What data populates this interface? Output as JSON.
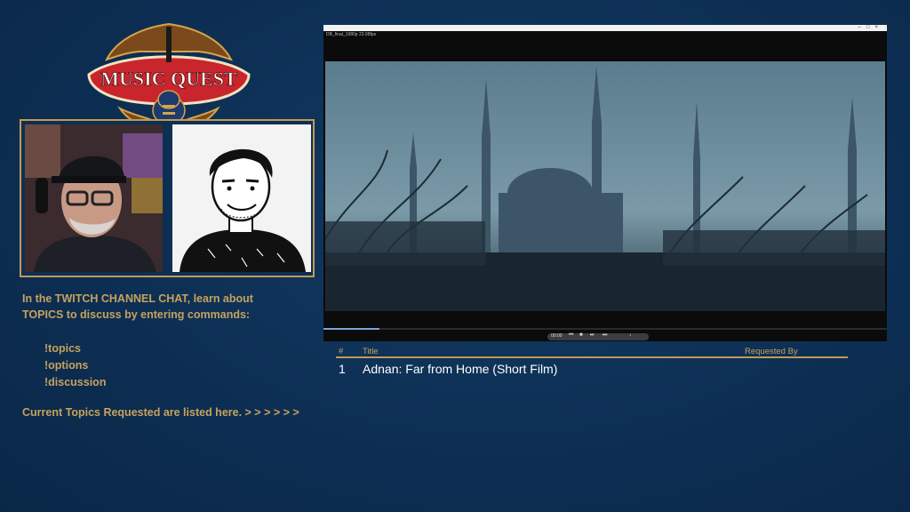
{
  "logo": {
    "text": "MUSIC QUEST"
  },
  "info": {
    "line1": "In the TWITCH CHANNEL CHAT, learn about",
    "line2": "TOPICS to discuss by entering commands:",
    "commands": [
      "!topics",
      "!options",
      "!discussion"
    ],
    "current": "Current Topics Requested are listed here. > > > > > >"
  },
  "player": {
    "window_title": "DB_final_1080p 23.98fps",
    "time": "00:00",
    "progress": 0.1
  },
  "queue": {
    "headers": {
      "num": "#",
      "title": "Title",
      "requested_by": "Requested By"
    },
    "rows": [
      {
        "num": "1",
        "title": "Adnan: Far from Home (Short Film)",
        "requested_by": ""
      }
    ]
  },
  "colors": {
    "accent": "#c7a25e",
    "background": "#0d2f54",
    "logo_red": "#c8262c"
  },
  "icons": [
    "guitar-icon",
    "previous-icon",
    "play-pause-icon",
    "next-icon",
    "stop-icon",
    "volume-icon"
  ]
}
